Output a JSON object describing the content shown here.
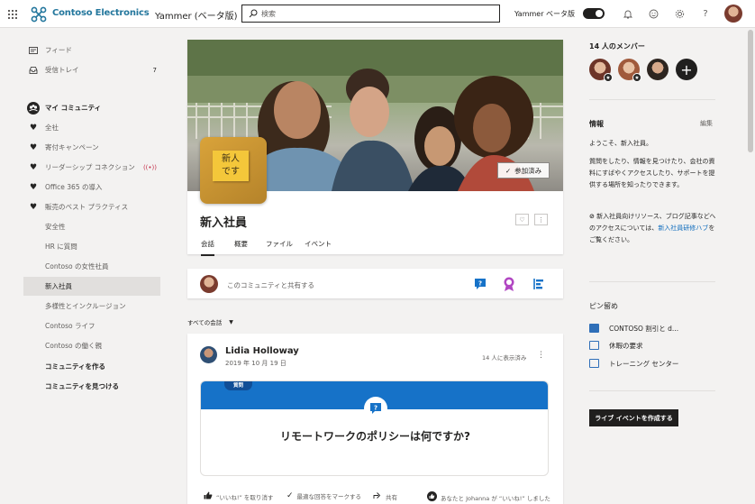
{
  "topbar": {
    "brand": "Contoso Electronics",
    "app_name": "Yammer (ベータ版)",
    "search_placeholder": "検索",
    "toggle_label": "Yammer ベータ版"
  },
  "nav": {
    "feed": "フィード",
    "inbox": "受信トレイ",
    "inbox_count": "7",
    "my_communities": "マイ コミュニティ",
    "communities": [
      {
        "label": "全社",
        "favorite": true
      },
      {
        "label": "寄付キャンペーン",
        "favorite": true
      },
      {
        "label": "リーダーシップ コネクション",
        "favorite": true,
        "live": "((•))"
      },
      {
        "label": "Office 365 の導入",
        "favorite": true
      },
      {
        "label": "販売のベスト プラクティス",
        "favorite": true
      },
      {
        "label": "安全性",
        "favorite": false
      },
      {
        "label": "HR に質問",
        "favorite": false
      },
      {
        "label": "Contoso の女性社員",
        "favorite": false
      },
      {
        "label": "新入社員",
        "favorite": false,
        "selected": true
      },
      {
        "label": "多様性とインクルージョン",
        "favorite": false
      },
      {
        "label": "Contoso ライフ",
        "favorite": false
      },
      {
        "label": "Contoso の働く親",
        "favorite": false
      }
    ],
    "create_community": "コミュニティを作る",
    "discover_community": "コミュニティを見つける"
  },
  "community": {
    "tile_text": "新人\nです",
    "joined_label": "参加済み",
    "title": "新入社員",
    "tabs": [
      "会話",
      "概要",
      "ファイル",
      "イベント"
    ],
    "active_tab": "会話",
    "share_placeholder": "このコミュニティと共有する"
  },
  "feed": {
    "filter_label": "すべての会話",
    "post": {
      "author": "Lidia Holloway",
      "date": "2019 年 10 月 19 日",
      "views": "14 人に表示済み",
      "tag": "質問",
      "question": "リモートワークのポリシーは何ですか?",
      "actions": {
        "unlike": "“いいね!” を取り消す",
        "mark_best": "最適な回答をマークする",
        "share": "共有",
        "liked_by": "あなたと Johanna が “いいね!” しました"
      }
    }
  },
  "right": {
    "members_title": "14 人のメンバー",
    "info_title": "情報",
    "edit_label": "編集",
    "welcome": "ようこそ、新入社員。",
    "description": "質問をしたり、情報を見つけたり、会社の資料にすばやくアクセスしたり、サポートを提供する場所を知ったりできます。",
    "resources_prefix": "新入社員向けリソース、ブログ記事などへのアクセスについては、",
    "resources_link": "新入社員研修ハブ",
    "resources_suffix": "をご覧ください。",
    "pinned_title": "ピン留め",
    "pinned": [
      "CONTOSO 割引と d...",
      "休暇の要求",
      "トレーニング センター"
    ],
    "live_event_button": "ライブ イベントを作成する"
  },
  "colors": {
    "brand": "#24779d",
    "link": "#0f6cbd",
    "question_band": "#1672c8",
    "live": "#c4314b"
  }
}
